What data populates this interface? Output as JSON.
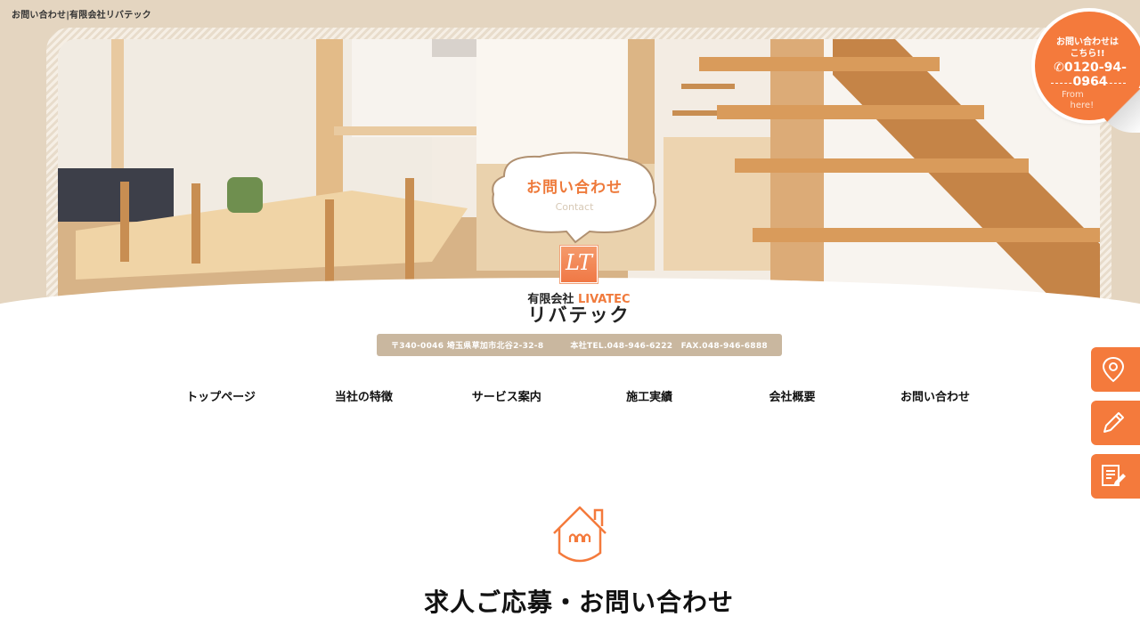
{
  "page_heading": "お問い合わせ|有限会社リバテック",
  "hero": {
    "bubble_title": "お問い合わせ",
    "bubble_subtitle": "Contact",
    "logo_glyph": "LT"
  },
  "brand": {
    "prefix": "有限会社",
    "english": "LIVATEC",
    "name": "リバテック"
  },
  "address_bar": {
    "address": "〒340-0046 埼玉県草加市北谷2-32-8",
    "contact": "本社TEL.048-946-6222　FAX.048-946-6888"
  },
  "nav": {
    "items": [
      {
        "label": "トップページ"
      },
      {
        "label": "当社の特徴"
      },
      {
        "label": "サービス案内"
      },
      {
        "label": "施工実績"
      },
      {
        "label": "会社概要"
      },
      {
        "label": "お問い合わせ"
      }
    ]
  },
  "section": {
    "title": "求人ご応募・お問い合わせ"
  },
  "phone_badge": {
    "line1": "お問い合わせは",
    "line2": "こちら!!",
    "phone": "0120-94-0964",
    "from1": "From",
    "from2": "here!"
  },
  "side_buttons": [
    {
      "icon": "map-pin-icon"
    },
    {
      "icon": "pencil-icon"
    },
    {
      "icon": "document-pen-icon"
    }
  ],
  "colors": {
    "accent": "#f47a3c",
    "beige": "#e4d5c0",
    "address_bar": "#c9b79f"
  }
}
